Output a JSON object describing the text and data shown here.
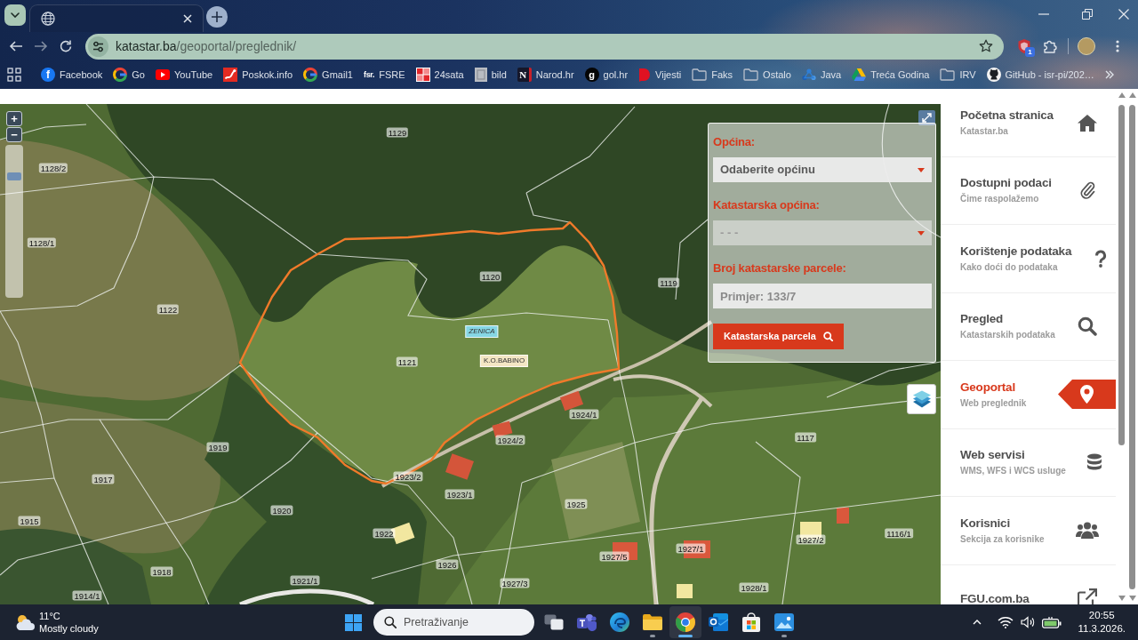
{
  "browser": {
    "address_bar": {
      "host": "katastar.ba",
      "path": "/geoportal/preglednik/"
    },
    "extension_badge": "1",
    "bookmarks": [
      {
        "label": "Facebook",
        "kind": "facebook",
        "icon_text": "f"
      },
      {
        "label": "Go",
        "kind": "google"
      },
      {
        "label": "YouTube",
        "kind": "youtube"
      },
      {
        "label": "Poskok.info",
        "kind": "poskok"
      },
      {
        "label": "Gmail1",
        "kind": "google"
      },
      {
        "label": "FSRE",
        "kind": "fsr",
        "icon_text": "fsr."
      },
      {
        "label": "24sata",
        "kind": "news"
      },
      {
        "label": "bild",
        "kind": "bild"
      },
      {
        "label": "Narod.hr",
        "kind": "narod",
        "icon_text": "N"
      },
      {
        "label": "gol.hr",
        "kind": "gol",
        "icon_text": "g"
      },
      {
        "label": "Vijesti",
        "kind": "vijesti"
      },
      {
        "label": "Faks",
        "kind": "folder"
      },
      {
        "label": "Ostalo",
        "kind": "folder"
      },
      {
        "label": "Java",
        "kind": "java"
      },
      {
        "label": "Treća Godina",
        "kind": "drive"
      },
      {
        "label": "IRV",
        "kind": "folder"
      },
      {
        "label": "GitHub - isr-pi/202…",
        "kind": "github"
      }
    ]
  },
  "map": {
    "zoom_in": "+",
    "zoom_out": "−",
    "zoom_slider": {
      "level": 0.82
    },
    "parcel_labels": [
      "1129",
      "1128/2",
      "1128/1",
      "1122",
      "1120",
      "1119",
      "1121",
      "1919",
      "1917",
      "1915",
      "1920",
      "1918",
      "1921/1",
      "1914/1",
      "1923/2",
      "1923/1",
      "1924/1",
      "1924/2",
      "1925",
      "1922",
      "1926",
      "1927/3",
      "1927/5",
      "1927/1",
      "1927/2",
      "1928/1",
      "1117",
      "1116/1"
    ],
    "place_tags": [
      {
        "text": "ZENICA",
        "kind": "municipality"
      },
      {
        "text": "K.O.BABINO",
        "kind": "cadastral"
      }
    ]
  },
  "search_form": {
    "fields": [
      {
        "label": "Općina:",
        "kind": "select",
        "value": "Odaberite općinu",
        "disabled": false
      },
      {
        "label": "Katastarska općina:",
        "kind": "select",
        "value": "- - -",
        "disabled": true
      },
      {
        "label": "Broj katastarske parcele:",
        "kind": "input",
        "placeholder": "Primjer: 133/7",
        "disabled": false
      }
    ],
    "button": "Katastarska parcela"
  },
  "sidebar": {
    "items": [
      {
        "title": "Početna stranica",
        "subtitle": "Katastar.ba",
        "kind": "home",
        "selected": false
      },
      {
        "title": "Dostupni podaci",
        "subtitle": "Čime raspolažemo",
        "kind": "paperclip",
        "selected": false
      },
      {
        "title": "Korištenje podataka",
        "subtitle": "Kako doći do podataka",
        "kind": "question",
        "selected": false
      },
      {
        "title": "Pregled",
        "subtitle": "Katastarskih podataka",
        "kind": "search",
        "selected": false
      },
      {
        "title": "Geoportal",
        "subtitle": "Web preglednik",
        "kind": "marker",
        "selected": true
      },
      {
        "title": "Web servisi",
        "subtitle": "WMS, WFS i WCS usluge",
        "kind": "database",
        "selected": false
      },
      {
        "title": "Korisnici",
        "subtitle": "Sekcija za korisnike",
        "kind": "users",
        "selected": false
      },
      {
        "title": "FGU.com.ba",
        "kind": "external",
        "selected": false
      }
    ]
  },
  "taskbar": {
    "weather": {
      "temperature": "11°C",
      "condition": "Mostly cloudy"
    },
    "search": {
      "placeholder": "Pretraživanje"
    },
    "apps": [
      {
        "kind": "taskview",
        "running": false,
        "selected": false
      },
      {
        "kind": "teams",
        "running": false,
        "selected": false
      },
      {
        "kind": "edge",
        "running": false,
        "selected": false
      },
      {
        "kind": "explorer",
        "running": true,
        "selected": false
      },
      {
        "kind": "chrome",
        "running": true,
        "selected": true
      },
      {
        "kind": "outlook",
        "running": false,
        "selected": false
      },
      {
        "kind": "store",
        "running": false,
        "selected": false
      },
      {
        "kind": "photos",
        "running": true,
        "selected": false
      }
    ],
    "time": "20:55",
    "date": "11.3.2026."
  }
}
